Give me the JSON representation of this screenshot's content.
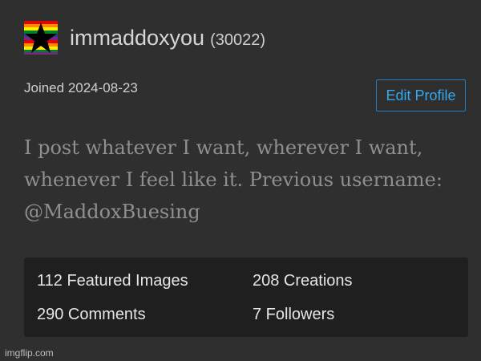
{
  "profile": {
    "username": "immaddoxyou",
    "points": "(30022)",
    "joined": "Joined 2024-08-23",
    "edit_label": "Edit Profile",
    "bio": "I post whatever I want, wherever I want, whenever I feel like it. Previous username: @MaddoxBuesing",
    "avatar_icon": "pride-flag-star-icon"
  },
  "stats": {
    "featured": "112 Featured Images",
    "creations": "208 Creations",
    "comments": "290 Comments",
    "followers": "7 Followers"
  },
  "watermark": "imgflip.com",
  "colors": {
    "background": "#2f2f2f",
    "stats_panel": "#1f1f1f",
    "accent": "#34a8f0"
  }
}
